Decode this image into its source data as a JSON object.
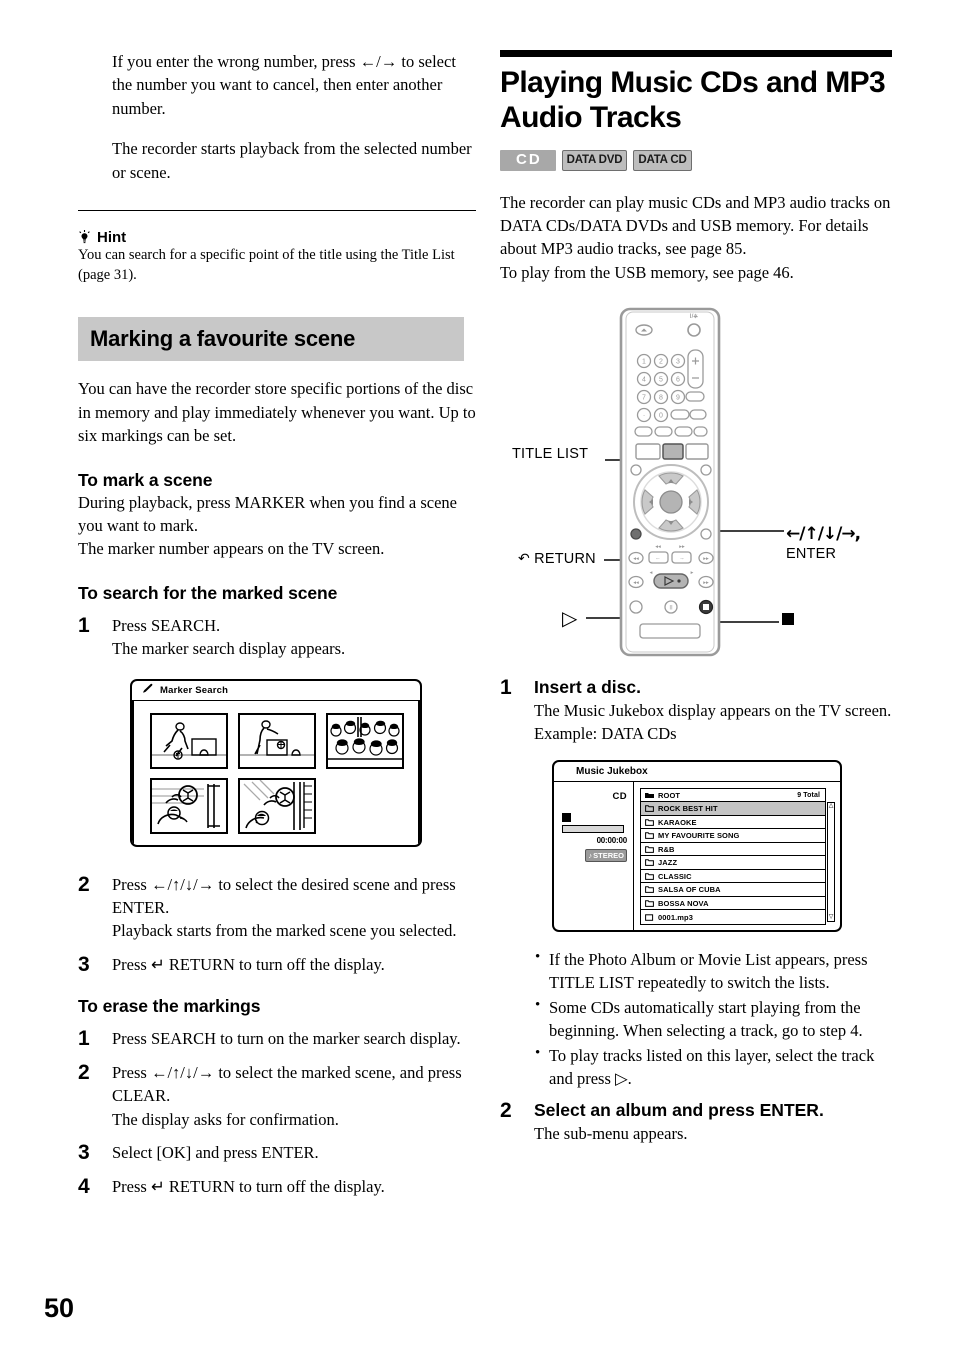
{
  "page_number": "50",
  "left_column": {
    "intro_paragraph_1": "If you enter the wrong number, press ←/→ to select the number you want to cancel, then enter another number.",
    "intro_paragraph_2": "The recorder starts playback from the selected number or scene.",
    "hint": {
      "icon": "lightbulb-icon",
      "heading": "Hint",
      "body": "You can search for a specific point of the title using the Title List (page 31)."
    },
    "section_heading": "Marking a favourite scene",
    "section_intro": "You can have the recorder store specific portions of the disc in memory and play immediately whenever you want. Up to six markings can be set.",
    "sub_sections": [
      {
        "heading": "To mark a scene",
        "body": "During playback, press MARKER when you find a scene you want to mark.\nThe marker number appears on the TV screen."
      },
      {
        "heading": "To search for the marked scene",
        "steps": [
          {
            "num": "1",
            "lead": "Press SEARCH.",
            "sub": "The marker search display appears."
          },
          {
            "num": "2",
            "lead": "Press ←/↑/↓/→ to select the desired scene and press ENTER.",
            "sub": "Playback starts from the marked scene you selected."
          },
          {
            "num": "3",
            "lead": "Press ↵ RETURN to turn off the display.",
            "sub": ""
          }
        ]
      },
      {
        "heading": "To erase the markings",
        "steps": [
          {
            "num": "1",
            "lead": "Press SEARCH to turn on the marker search display.",
            "sub": ""
          },
          {
            "num": "2",
            "lead": "Press ←/↑/↓/→ to select the marked scene, and press CLEAR.",
            "sub": "The display asks for confirmation."
          },
          {
            "num": "3",
            "lead": "Select [OK] and press ENTER.",
            "sub": ""
          },
          {
            "num": "4",
            "lead": "Press ↵ RETURN to turn off the display.",
            "sub": ""
          }
        ]
      }
    ],
    "marker_search_figure": {
      "window_title": "Marker Search",
      "title_icon": "marker-pen-icon",
      "thumbnails": [
        "soccer-player-kicking",
        "soccer-player-shooting",
        "crowd-of-fans",
        "goalkeeper-saving-ball",
        "goalkeeper-catching-ball"
      ]
    }
  },
  "right_column": {
    "title": "Playing Music CDs and MP3 Audio Tracks",
    "badges": [
      {
        "label": "CD",
        "style": "filled"
      },
      {
        "label": "DATA DVD",
        "style": "outline"
      },
      {
        "label": "DATA CD",
        "style": "outline"
      }
    ],
    "intro": "The recorder can play music CDs and MP3 audio tracks on DATA CDs/DATA DVDs and USB memory. For details about MP3 audio tracks, see page 85.\nTo play from the USB memory, see page 46.",
    "remote_figure": {
      "labels": {
        "title_list": "TITLE LIST",
        "return": "RETURN",
        "return_icon": "return-arrow-icon",
        "direction_enter_line1": "←/↑/↓/→,",
        "direction_enter_line2": "ENTER",
        "play": "▷",
        "stop": "■",
        "power_icon": "power-icon",
        "eject_icon": "eject-icon"
      },
      "number_keys": [
        "1",
        "2",
        "3",
        "4",
        "5",
        "6",
        "7",
        "8",
        "9",
        "0"
      ]
    },
    "steps": [
      {
        "num": "1",
        "lead": "Insert a disc.",
        "sub_lines": [
          "The Music Jukebox display appears on the TV screen.",
          "Example: DATA CDs"
        ]
      },
      {
        "num": "2",
        "lead": "Select an album and press ENTER.",
        "sub_lines": [
          "The sub-menu appears."
        ]
      }
    ],
    "jukebox_figure": {
      "window_title": "Music Jukebox",
      "source_label": "CD",
      "time": "00:00:00",
      "audio_badge": "STEREO",
      "status_icon": "stop-icon",
      "list_header": {
        "label": "ROOT",
        "icon": "open-folder-icon",
        "count": "9 Total"
      },
      "rows": [
        {
          "label": "ROCK BEST HIT",
          "icon": "folder-icon",
          "selected": true
        },
        {
          "label": "KARAOKE",
          "icon": "folder-icon",
          "selected": false
        },
        {
          "label": "MY FAVOURITE SONG",
          "icon": "folder-icon",
          "selected": false
        },
        {
          "label": "R&B",
          "icon": "folder-icon",
          "selected": false
        },
        {
          "label": "JAZZ",
          "icon": "folder-icon",
          "selected": false
        },
        {
          "label": "CLASSIC",
          "icon": "folder-icon",
          "selected": false
        },
        {
          "label": "SALSA OF CUBA",
          "icon": "folder-icon",
          "selected": false
        },
        {
          "label": "BOSSA NOVA",
          "icon": "folder-icon",
          "selected": false
        },
        {
          "label": "0001.mp3",
          "icon": "file-icon",
          "selected": false
        }
      ]
    },
    "bullets": [
      "If the Photo Album or Movie List appears, press TITLE LIST repeatedly to switch the lists.",
      "Some CDs automatically start playing from the beginning. When selecting a track, go to step 4.",
      "To play tracks listed on this layer, select the track and press ▷."
    ]
  }
}
